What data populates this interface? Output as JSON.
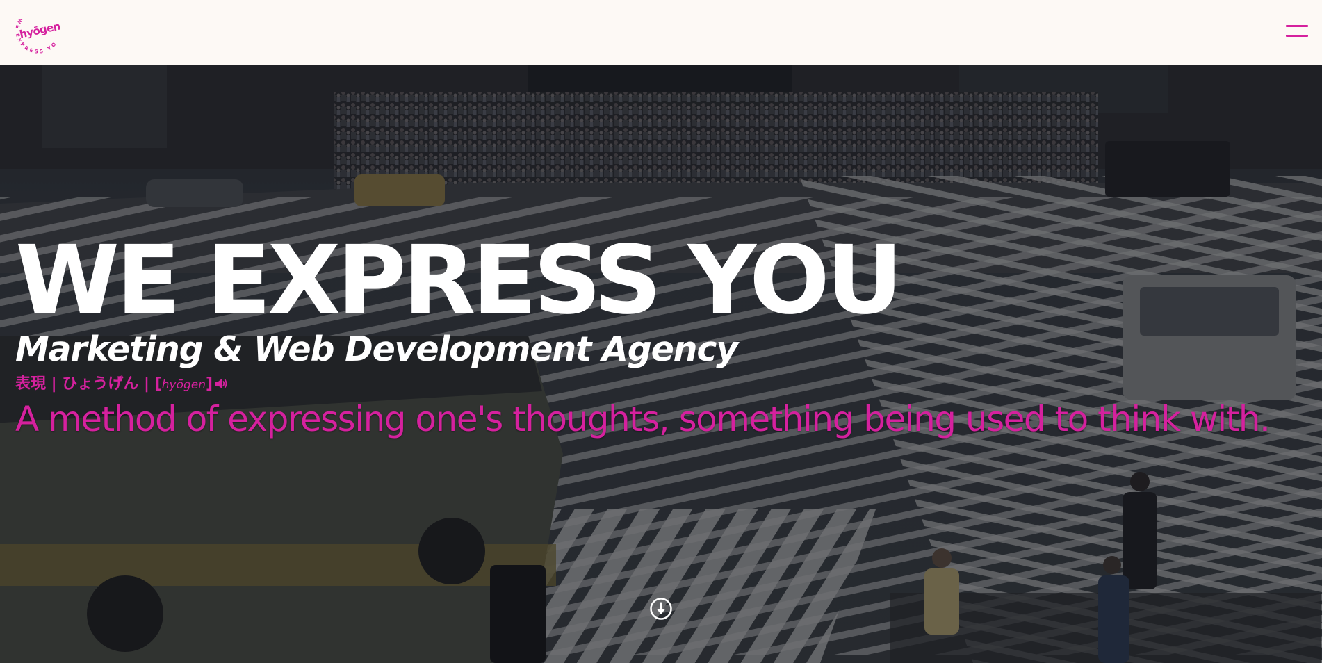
{
  "header": {
    "logo": {
      "text": "hyōgen",
      "ring_text": "WE EXPRESS YOU"
    },
    "menu_icon": "hamburger-menu-icon"
  },
  "hero": {
    "background": "blurred city crosswalk photo",
    "title": "WE EXPRESS YOU",
    "subtitle": "Marketing & Web Development Agency",
    "pronunciation": {
      "japanese": "表現 | ひょうげん | [",
      "romaji": "hyōgen",
      "close": "]"
    },
    "speaker_icon": "speaker-icon",
    "definition": "A method of expressing one's thoughts, something being used to think with.",
    "scroll_icon": "arrow-down-circle-icon"
  },
  "colors": {
    "accent": "#d5219e",
    "header_bg": "#fdf9f5",
    "text": "#ffffff"
  }
}
